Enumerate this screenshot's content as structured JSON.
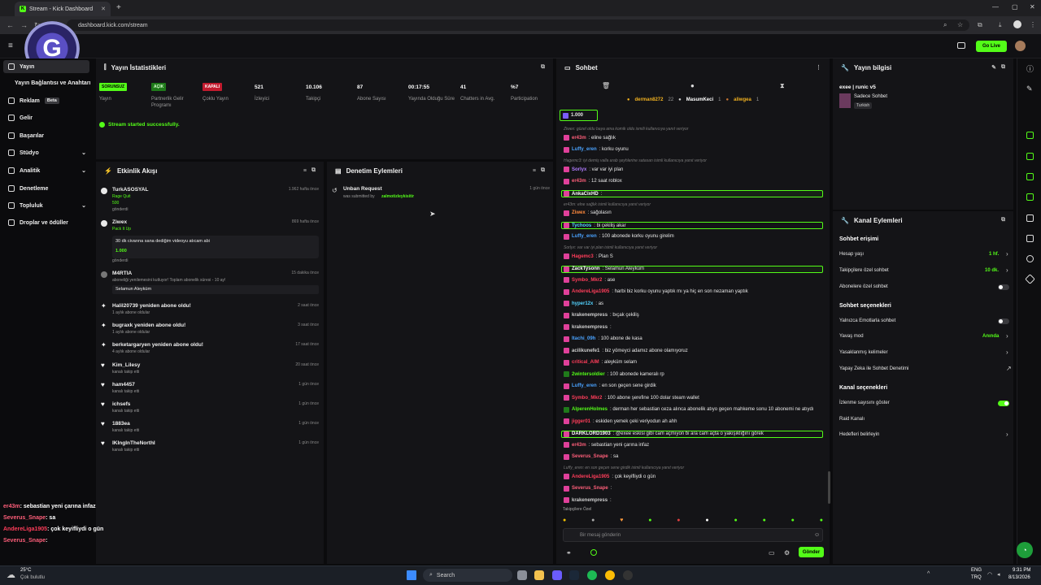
{
  "browser": {
    "tab_title": "Stream - Kick Dashboard",
    "url": "dashboard.kick.com/stream",
    "new_tab": "+"
  },
  "topbar": {
    "go_live": "Go Live"
  },
  "sidebar": {
    "items": [
      {
        "label": "Yayın",
        "icon": "broadcast-icon"
      },
      {
        "label": "Yayın Bağlantısı ve Anahtarı",
        "icon": "link-icon"
      },
      {
        "label": "Reklam",
        "badge": "Beta",
        "icon": "ad-icon"
      },
      {
        "label": "Gelir",
        "icon": "money-icon"
      },
      {
        "label": "Başarılar",
        "icon": "trophy-icon"
      },
      {
        "label": "Stüdyo",
        "icon": "studio-icon"
      },
      {
        "label": "Analitik",
        "icon": "chart-icon"
      },
      {
        "label": "Denetleme",
        "icon": "shield-icon"
      },
      {
        "label": "Topluluk",
        "icon": "people-icon"
      },
      {
        "label": "Droplar ve ödüller",
        "icon": "gift-icon"
      }
    ]
  },
  "stats": {
    "title": "Yayın İstatistikleri",
    "success": "Stream started successfully.",
    "items": [
      {
        "value": "SORUNSUZ",
        "label": "Yayın",
        "kind": "badge-green"
      },
      {
        "value": "AÇIK",
        "label": "Partnerlik Gelir Programı",
        "kind": "badge-darkgreen"
      },
      {
        "value": "KAPALI",
        "label": "Çoklu Yayın",
        "kind": "badge-red"
      },
      {
        "value": "521",
        "label": "İzleyici"
      },
      {
        "value": "10.106",
        "label": "Takipçi"
      },
      {
        "value": "87",
        "label": "Abone Sayısı"
      },
      {
        "value": "00:17:55",
        "label": "Yayında Olduğu Süre"
      },
      {
        "value": "41",
        "label": "Chatters in Avg."
      },
      {
        "value": "%7",
        "label": "Participation"
      }
    ]
  },
  "activity": {
    "title": "Etkinlik Akışı",
    "events": [
      {
        "user": "TurkASOSYAL",
        "sub1": "Rage Quit",
        "sub2": "500",
        "sub3": "gönderdi",
        "time": "1.962 hafta önce"
      },
      {
        "user": "Ziwex",
        "sub1": "Pack It Up",
        "msg": "30 dk civarına sana dediğim videoyu atıcam abi",
        "sub2": "1.000",
        "sub3": "gönderdi",
        "time": "869 hafta önce"
      },
      {
        "user": "M4RTIA",
        "sub1": "aboneliği yenilemesini kutluyor! Toplam abonelik süresi - 10 ay!",
        "msg": "Selamun Aleyküm",
        "time": "15 dakika önce"
      },
      {
        "user": "Halil20739 yeniden abone oldu!",
        "sub1": "1 aylık abone oldular",
        "time": "2 saat önce"
      },
      {
        "user": "bugraxk yeniden abone oldu!",
        "sub1": "1 aylık abone oldular",
        "time": "3 saat önce"
      },
      {
        "user": "berketargaryen yeniden abone oldu!",
        "sub1": "4 aylık abone oldular",
        "time": "17 saat önce"
      },
      {
        "user": "Kim_Lilesy",
        "sub1": "kanalı takip etti",
        "time": "20 saat önce"
      },
      {
        "user": "ham4457",
        "sub1": "kanalı takip etti",
        "time": "1 gün önce"
      },
      {
        "user": "ichsefs",
        "sub1": "kanalı takip etti",
        "time": "1 gün önce"
      },
      {
        "user": "1883ea",
        "sub1": "kanalı takip etti",
        "time": "1 gün önce"
      },
      {
        "user": "IKIngInTheNorthI",
        "sub1": "kanalı takip etti",
        "time": "1 gün önce"
      }
    ]
  },
  "moderation": {
    "title": "Denetim Eylemleri",
    "items": [
      {
        "title": "Unban Request",
        "sub": "was submitted by",
        "by": "zalmotizleykisitir",
        "time": "1 gün önce"
      }
    ]
  },
  "chat": {
    "title": "Sohbet",
    "pinned": [
      "derman8272",
      "22",
      "MasumKeci",
      "1",
      "aliwgea",
      "1"
    ],
    "gift": "1.000",
    "placeholder": "Bir mesaj gönderin",
    "send": "Gönder",
    "followers_only": "Takipçilere Özel",
    "messages": [
      {
        "sys": "Ziwex: güzel oldu baya ama komik oldu ismili kullanıcıya yanıt veriyor"
      },
      {
        "u": "er43m",
        "c": "#ff5f7a",
        "m": ": eline sağlık"
      },
      {
        "u": "Luffy_eren",
        "c": "#4aa3ff",
        "m": ": korku oyunu"
      },
      {
        "sys": "Hagemc3: iyi demiş valla arab şeyhlerine satasan isimli kullanıcıya yanıt veriyor"
      },
      {
        "u": "Sorlyx",
        "c": "#b07cff",
        "m": ": var var iyi plan"
      },
      {
        "u": "er43m",
        "c": "#ff5f7a",
        "m": ": 12 saat roblox"
      },
      {
        "u": "AnkaCixHD",
        "c": "#fff",
        "m": ":",
        "hl": true
      },
      {
        "sys": "er43m: elne sağlık isimli kullanıcıya yanıt veriyor"
      },
      {
        "u": "Ziwex",
        "c": "#ff8a3d",
        "m": ": sağolasın"
      },
      {
        "u": "Tychoos",
        "c": "#53d3ff",
        "m": ": bi çekiliş akar",
        "hl2": true
      },
      {
        "u": "Luffy_eren",
        "c": "#4aa3ff",
        "m": ": 100 abonede korku oyunu girelim"
      },
      {
        "sys": "Sorlyx: var var iyi plan isimli kullanıcıya yanıt veriyor"
      },
      {
        "u": "Hagemc3",
        "c": "#ff3d5a",
        "m": ": Plan S"
      },
      {
        "u": "ZackTysonn",
        "c": "#fff",
        "m": ": Selamun Aleyküm",
        "hl": true
      },
      {
        "u": "Symbo_Mkr2",
        "c": "#ff3d5a",
        "m": ": ase"
      },
      {
        "u": "AndereLiga1905",
        "c": "#ff3d5a",
        "m": ": harbi biz korku oyunu yaptık mı ya hiç en son nezaman yaptık"
      },
      {
        "u": "hyper12x",
        "c": "#53d3ff",
        "m": ": as"
      },
      {
        "u": "krakenempress",
        "c": "#cfcfcf",
        "m": ": bıçak çekiliş"
      },
      {
        "u": "krakenempress",
        "c": "#cfcfcf",
        "m": ":"
      },
      {
        "u": "Itachi_09h",
        "c": "#4aa3ff",
        "m": ": 100 abone de kasa"
      },
      {
        "u": "acilikunefe1",
        "c": "#cfcfcf",
        "m": ": biz yömeyci adamız abone olamıyoruz"
      },
      {
        "u": "critical_AIM",
        "c": "#ff3d5a",
        "m": ": aleyküm selam"
      },
      {
        "u": "2wintersoldier",
        "c": "#53fc18",
        "m": ": 100 abonede kameralı rp"
      },
      {
        "u": "Luffy_eren",
        "c": "#4aa3ff",
        "m": ": en son geçen sene girdik"
      },
      {
        "u": "Symbo_Mkr2",
        "c": "#ff3d5a",
        "m": ": 100 abone şerefine 100 dolar steam wallet"
      },
      {
        "u": "AlperenHolmes",
        "c": "#53fc18",
        "m": ": derman her sebastian ceza alınca abonelik atıyo geçen mahkeme sonu 10 abonemi ne atıydı"
      },
      {
        "u": "jigger01",
        "c": "#ff3d5a",
        "m": ": eskiden yemek çeki veriyodun ah ahh"
      },
      {
        "u": "DARKLORD1903",
        "c": "#fff",
        "m": ": @exee eskisi gibi cam açmıyon bi ara cam açta o yakışıklığını görek",
        "hl2": true
      },
      {
        "u": "er43m",
        "c": "#ff5f7a",
        "m": ": sebastian yeni çarına infaz"
      },
      {
        "u": "Severus_Snape",
        "c": "#ff5f7a",
        "m": ": sa"
      },
      {
        "sys": "Luffy_eren: en son geçen sene girdik isimli kullanıcıya yanıt veriyor"
      },
      {
        "u": "AndereLiga1905",
        "c": "#ff3d5a",
        "m": ": çok keyifliydi o gün"
      },
      {
        "u": "Severus_Snape",
        "c": "#ff5f7a",
        "m": ":"
      },
      {
        "u": "krakenempress",
        "c": "#cfcfcf",
        "m": ":"
      }
    ]
  },
  "stream_info": {
    "title": "Yayın bilgisi",
    "stream_title": "exee | runic v5",
    "mode": "Sadece Sohbet",
    "language": "Turkish"
  },
  "channel_actions": {
    "title": "Kanal Eylemleri",
    "chat_access": "Sohbet erişimi",
    "account_age": "Hesap yaşı",
    "account_age_val": "1 hf.",
    "followers_chat": "Takipçilere özel sohbet",
    "followers_chat_val": "10 dk.",
    "subs_chat": "Abonelere özel sohbet",
    "chat_options": "Sohbet seçenekleri",
    "emotes_only": "Yalnızca Emotlarla sohbet",
    "slow_mode": "Yavaş mod",
    "slow_mode_val": "Anında",
    "banned_words": "Yasaklanmış kelimeler",
    "ai_mod": "Yapay Zeka ile Sohbet Denetimi",
    "channel_options": "Kanal seçenekleri",
    "show_viewers": "İzlenme sayısını göster",
    "raid": "Raid Kanalı",
    "goals": "Hedefleri belirleyin"
  },
  "overlay_chat": [
    {
      "u": "er43m",
      "c": "#ff5f7a",
      "m": ": sebastian yeni çarına infaz"
    },
    {
      "u": "Severus_Snape",
      "c": "#ff5f7a",
      "m": ": sa"
    },
    {
      "u": "AndereLiga1905",
      "c": "#ff3d5a",
      "m": ": çok keyifliydi o gün"
    },
    {
      "u": "Severus_Snape",
      "c": "#ff5f7a",
      "m": ":"
    }
  ],
  "taskbar": {
    "weather_temp": "25°C",
    "weather_desc": "Çok bulutlu",
    "search": "Search",
    "lang1": "ENG",
    "lang2": "TRQ",
    "time": "9:31 PM",
    "date": "8/13/2026"
  }
}
